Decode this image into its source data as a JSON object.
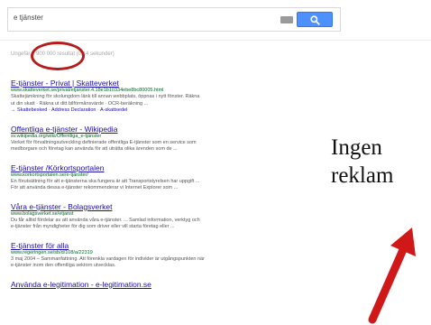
{
  "search": {
    "query": "e tjänster"
  },
  "stats": {
    "text": "Ungefär 4 900 000 resultat (0,14 sekunder)"
  },
  "results": [
    {
      "title": "E-tjänster - Privat | Skatteverket",
      "url": "www.skatteverket.se/privat/etjanster.4.18e1b10334ebe8bc80005.html",
      "snippet_lines": [
        "Skattejämkning för skolungdom länk till annan webbplats, öppnas i nytt fönster. Räkna",
        "ut din skatt · Räkna ut ditt bilförmånsvärde · OCR-beräkning ..."
      ],
      "sitelinks": "→ Skattebesked · Address Declaration · A-skattsedel"
    },
    {
      "title": "Offentliga e-tjänster - Wikipedia",
      "url": "sv.wikipedia.org/wiki/Offentliga_e-tjänster",
      "snippet_lines": [
        "Verket för förvaltningsutveckling definierade offentliga E-tjänster som en service som",
        "medborgare och företag kan använda för att uträtta olika ärenden som de ..."
      ]
    },
    {
      "title": "E-tjänster /Körkortsportalen",
      "url": "www.korkortsportalen.se/e-tjanster/",
      "snippet_lines": [
        "En förutsättning för att e-tjänsterna ska fungera är att Transportstyrelsen har uppgift ...",
        "För att använda dessa e-tjänster rekommenderar vi Internet Explorer som ..."
      ]
    },
    {
      "title": "Våra e-tjänster - Bolagsverket",
      "url": "www.bolagsverket.se/etjanst",
      "snippet_lines": [
        "Du får alltid fördelar av att använda våra e-tjänster. ... Samlad information, verktyg och",
        "e-tjänster från myndigheter för dig som driver eller vill starta företag eller ..."
      ]
    },
    {
      "title": "E-tjänster för alla",
      "url": "www.regeringen.se/sb/d/108/a/22319",
      "snippet_lines": [
        "3 maj 2004 – Sammanfattning. Att förenkla vardagen för individer är utgångspunkten när",
        "e-tjänster inom den offentliga sektorn utvecklas."
      ]
    },
    {
      "title": "Använda e-legitimation - e-legitimation.se"
    }
  ],
  "annotation": {
    "line1": "Ingen",
    "line2": "reklam"
  },
  "colors": {
    "link": "#1a0dab",
    "url": "#006621",
    "accent": "#4d90fe",
    "highlight": "#b71c1c"
  },
  "icons": [
    "keyboard-icon",
    "search-icon",
    "arrow-up-icon"
  ]
}
